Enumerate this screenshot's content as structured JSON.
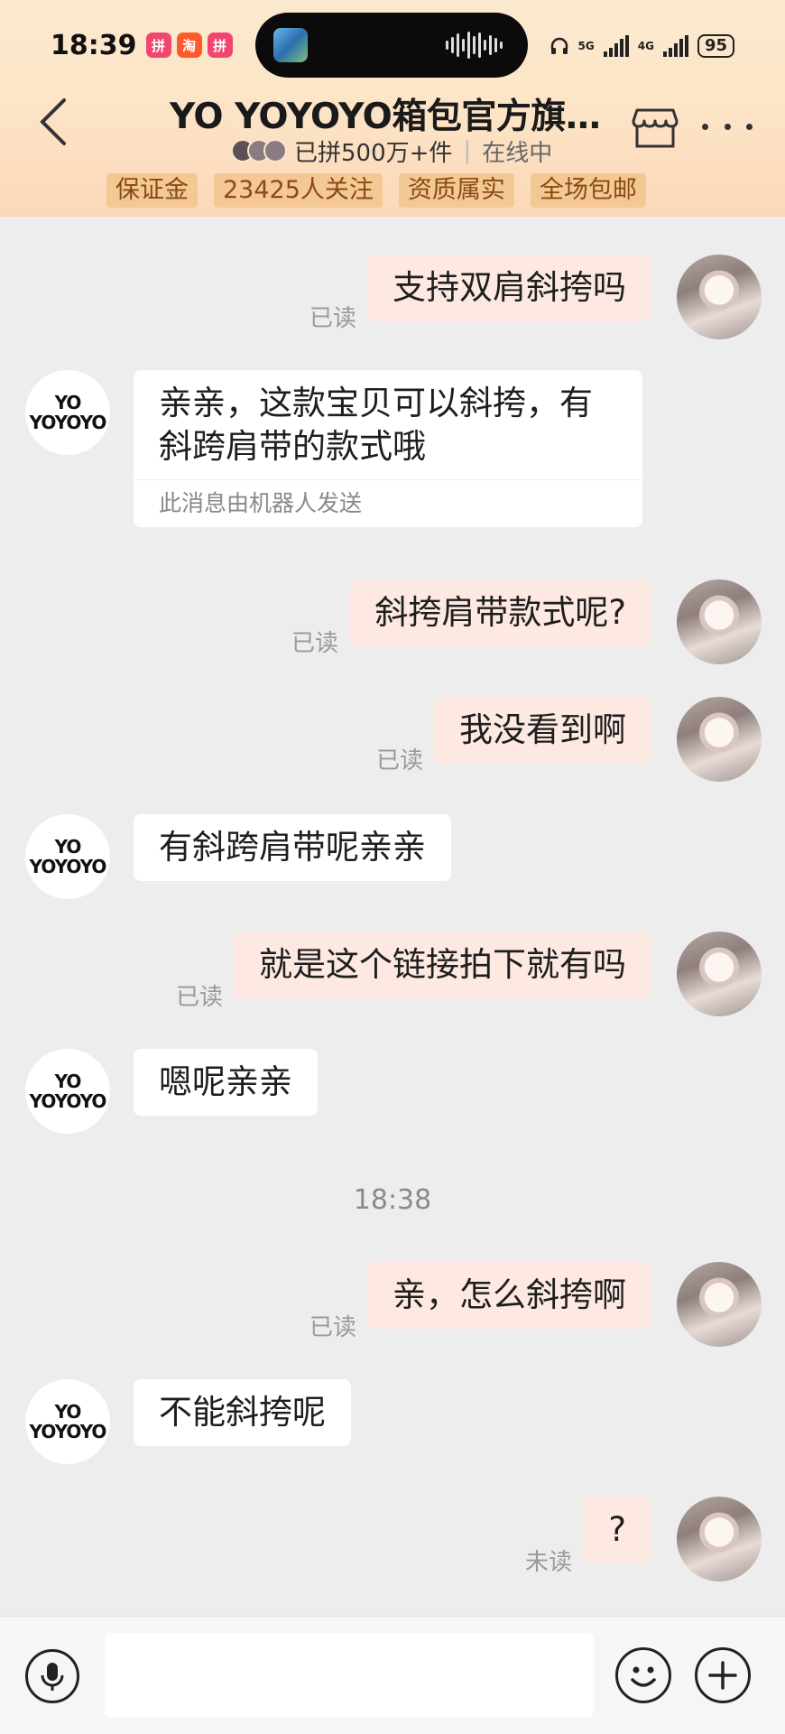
{
  "status_bar": {
    "time": "18:39",
    "battery": "95",
    "net1": "5G",
    "net2": "4G"
  },
  "header": {
    "title": "YO YOYOYO箱包官方旗舰...",
    "sales": "已拼500万+件",
    "online": "在线中",
    "tags": [
      "保证金",
      "23425人关注",
      "资质属实",
      "全场包邮"
    ]
  },
  "shop_logo": {
    "line1": "YO",
    "line2": "YOYOYO"
  },
  "messages": {
    "m1": {
      "text": "支持双肩斜挎吗",
      "status": "已读"
    },
    "m2": {
      "text": "亲亲，这款宝贝可以斜挎，有斜跨肩带的款式哦",
      "note": "此消息由机器人发送"
    },
    "m3": {
      "text": "斜挎肩带款式呢?",
      "status": "已读"
    },
    "m4": {
      "text": "我没看到啊",
      "status": "已读"
    },
    "m5": {
      "text": "有斜跨肩带呢亲亲"
    },
    "m6": {
      "text": "就是这个链接拍下就有吗",
      "status": "已读"
    },
    "m7": {
      "text": "嗯呢亲亲"
    },
    "timestamp": "18:38",
    "m8": {
      "text": "亲，怎么斜挎啊",
      "status": "已读"
    },
    "m9": {
      "text": "不能斜挎呢"
    },
    "m10": {
      "text": "?",
      "status": "未读"
    }
  },
  "input": {
    "placeholder": ""
  },
  "colors": {
    "outgoing_bubble": "#fde9e2",
    "tag_bg": "#f3c894",
    "tag_text": "#8a4a12"
  }
}
